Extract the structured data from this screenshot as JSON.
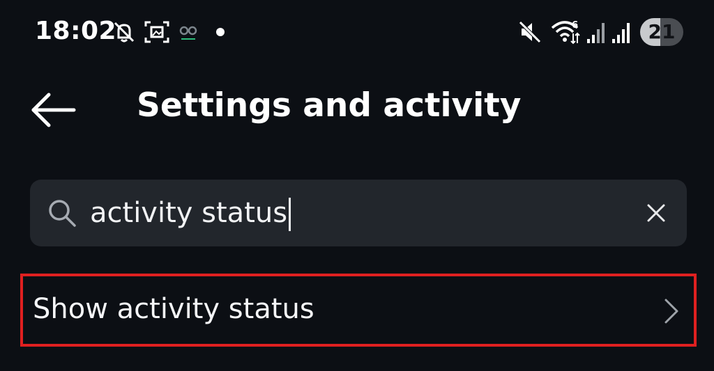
{
  "status_bar": {
    "time": "18:02",
    "battery_level": "21",
    "battery_fraction": 0.21,
    "icons": [
      "notifications-off-icon",
      "screenshot-icon",
      "link-icon",
      "dot-indicator",
      "mute-icon",
      "wifi-icon",
      "signal-icon",
      "signal-icon",
      "battery-icon"
    ]
  },
  "header": {
    "back_icon": "arrow-left-icon",
    "title": "Settings and activity"
  },
  "search": {
    "icon": "search-icon",
    "value": "activity status",
    "clear_icon": "close-icon"
  },
  "results": [
    {
      "label": "Show activity status",
      "icon": "chevron-right-icon",
      "highlighted": true
    }
  ],
  "colors": {
    "background": "#0c0f14",
    "search_background": "#22262c",
    "highlight_border": "#e02020",
    "text": "#f5f6f8"
  }
}
